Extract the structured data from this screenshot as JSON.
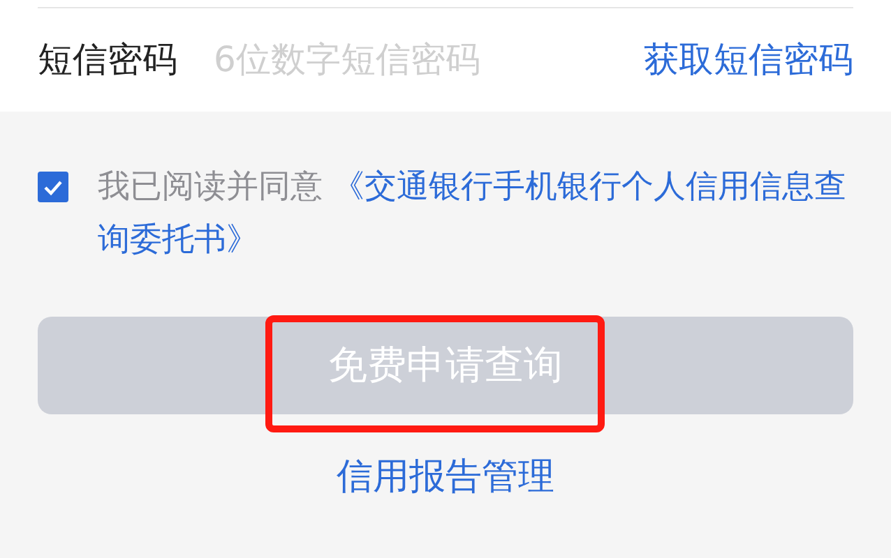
{
  "sms_row": {
    "label": "短信密码",
    "placeholder": "6位数字短信密码",
    "action": "获取短信密码"
  },
  "agreement": {
    "checked": true,
    "text": "我已阅读并同意",
    "link_lines": [
      "《交通银行手机银行个人信用信息查",
      "询委托书》"
    ]
  },
  "submit_button": {
    "label": "免费申请查询",
    "disabled": true
  },
  "annotation": {
    "kind": "rectangle"
  },
  "bottom_link": "信用报告管理"
}
